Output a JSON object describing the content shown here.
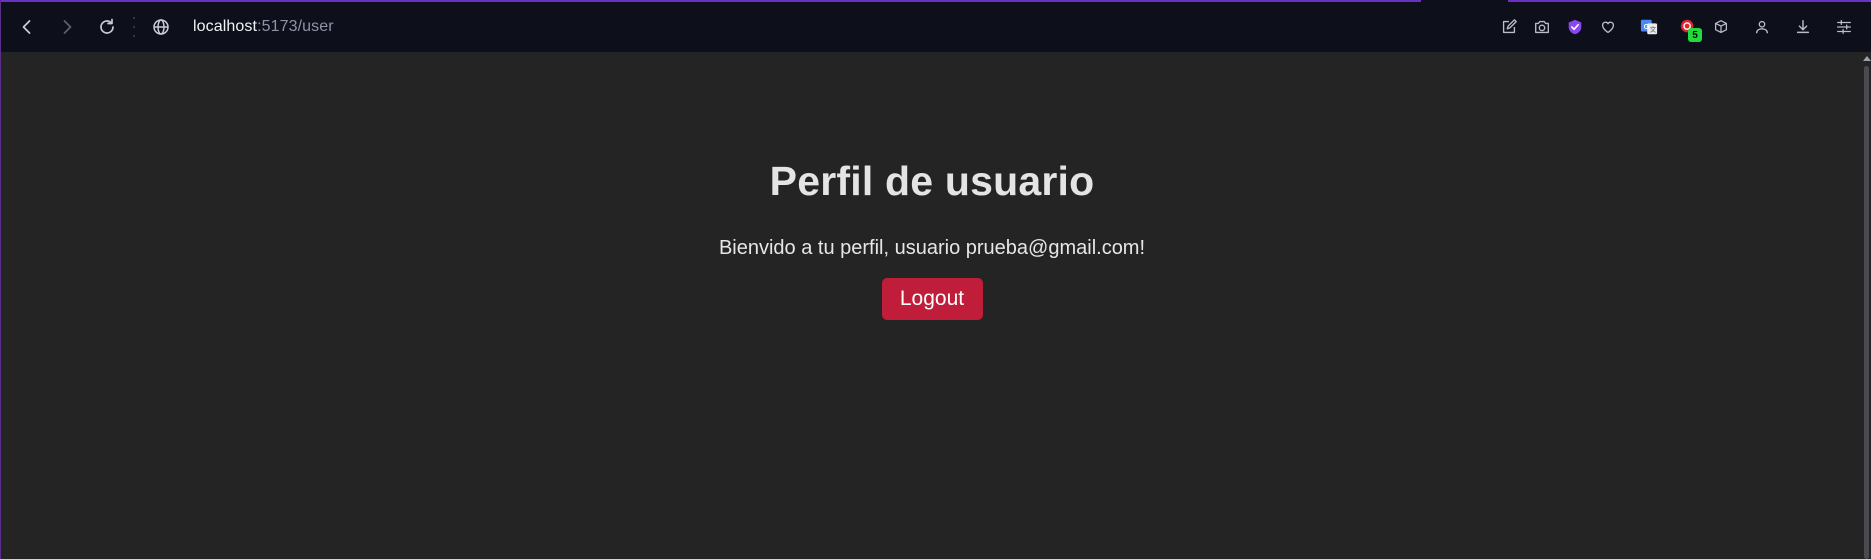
{
  "browser": {
    "url_host": "localhost",
    "url_path": ":5173/user",
    "extension_badge": "5",
    "icons": {
      "back": "back-arrow-icon",
      "forward": "forward-arrow-icon",
      "reload": "reload-icon",
      "site_info": "globe-icon",
      "edit": "edit-icon",
      "screenshot": "camera-icon",
      "vpn": "shield-check-icon",
      "favorite": "heart-icon",
      "translate": "translate-icon",
      "extension": "extension-badge-icon",
      "cube": "cube-icon",
      "profile": "person-icon",
      "downloads": "download-icon",
      "settings": "sliders-icon"
    },
    "colors": {
      "toolbar_bg": "#0d0f1a",
      "accent": "#6b2fc4",
      "badge": "#1fdc3b"
    }
  },
  "page": {
    "title": "Perfil de usuario",
    "welcome": "Bienvido a tu perfil, usuario prueba@gmail.com!",
    "logout_label": "Logout",
    "colors": {
      "background": "#242424",
      "button": "#c01d3a",
      "text": "#e4e4e4"
    }
  }
}
